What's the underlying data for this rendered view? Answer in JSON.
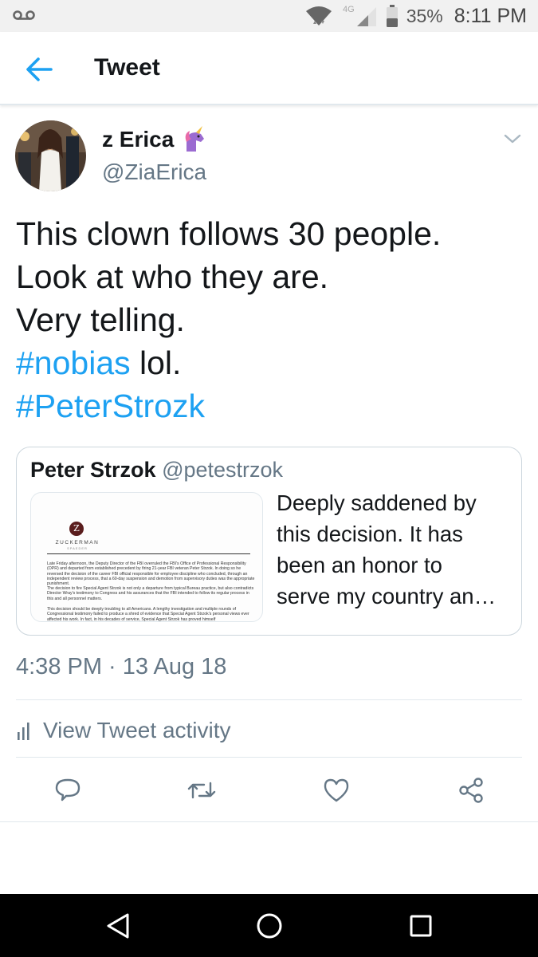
{
  "status_bar": {
    "network": "4G",
    "battery_percent": "35%",
    "time": "8:11 PM",
    "icons": [
      "voicemail-icon",
      "wifi-icon",
      "signal-icon",
      "battery-icon"
    ]
  },
  "header": {
    "title": "Tweet",
    "back_icon": "back-arrow-icon"
  },
  "tweet": {
    "author_name": "z Erica",
    "author_emoji_icon": "unicorn-icon",
    "author_handle": "@ZiaErica",
    "text_lines": [
      {
        "plain": "This clown follows 30 people."
      },
      {
        "plain": "Look at who they are."
      },
      {
        "plain": "Very telling."
      },
      {
        "hashtag": "#nobias",
        "plain": " lol."
      },
      {
        "hashtag": "#PeterStrozk"
      }
    ],
    "timestamp": "4:38 PM · 13 Aug 18"
  },
  "quoted_tweet": {
    "name": "Peter Strzok",
    "handle": "@petestrzok",
    "text_lines": [
      "Deeply saddened by",
      "this decision. It has",
      "been an honor to",
      "serve my country an…"
    ],
    "media": {
      "logo_letter": "Z",
      "brand": "ZUCKERMAN",
      "brand_sub": "SPAEDER",
      "paragraphs": [
        "Late Friday afternoon, the Deputy Director of the FBI overruled the FBI's Office of Professional Responsibility (OPR) and departed from established precedent by firing 21-year FBI veteran Peter Strzok. In doing so he reversed the decision of the career FBI official responsible for employee discipline who concluded, through an independent review process, that a 60-day suspension and demotion from supervisory duties was the appropriate punishment.",
        "The decision to fire Special Agent Strzok is not only a departure from typical Bureau practice, but also contradicts Director Wray's testimony to Congress and his assurances that the FBI intended to follow its regular process in this and all personnel matters.",
        "This decision should be deeply troubling to all Americans. A lengthy investigation and multiple rounds of Congressional testimony failed to produce a shred of evidence that Special Agent Strzok's personal views ever affected his work. In fact, in his decades of service, Special Agent Strzok has proved himself"
      ]
    }
  },
  "activity": {
    "label": "View Tweet activity",
    "icon": "bar-chart-icon"
  },
  "actions": [
    {
      "name": "reply-button",
      "icon": "reply-icon"
    },
    {
      "name": "retweet-button",
      "icon": "retweet-icon"
    },
    {
      "name": "like-button",
      "icon": "heart-icon"
    },
    {
      "name": "share-button",
      "icon": "share-icon"
    }
  ],
  "nav": [
    "back-triangle-icon",
    "home-circle-icon",
    "recents-square-icon"
  ],
  "colors": {
    "accent": "#1da1f2",
    "secondary_text": "#657786",
    "border": "#ccd6dd",
    "nav_bar": "#000000"
  }
}
